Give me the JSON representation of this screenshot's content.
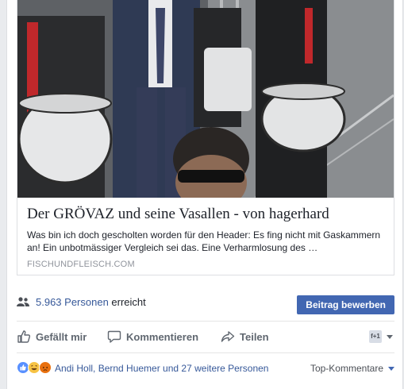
{
  "link_preview": {
    "title": "Der GRÖVAZ und seine Vasallen - von hagerhard",
    "description": "Was bin ich doch gescholten worden für den Header: Es fing nicht mit Gaskammern an! Ein unbotmässiger Vergleich sei das. Eine Verharmlosung des …",
    "domain": "FISCHUNDFLEISCH.COM"
  },
  "reach": {
    "count": "5.963 Personen",
    "suffix": "erreicht",
    "boost_label": "Beitrag bewerben"
  },
  "actions": {
    "like": "Gefällt mir",
    "comment": "Kommentieren",
    "share": "Teilen",
    "selector_initials": "f+1"
  },
  "reactions": {
    "names": "Andi Holl, Bernd Huemer und 27 weitere Personen",
    "sort_label": "Top-Kommentare"
  },
  "colors": {
    "accent": "#4267b2",
    "link": "#365899",
    "secondary_text": "#606770"
  }
}
